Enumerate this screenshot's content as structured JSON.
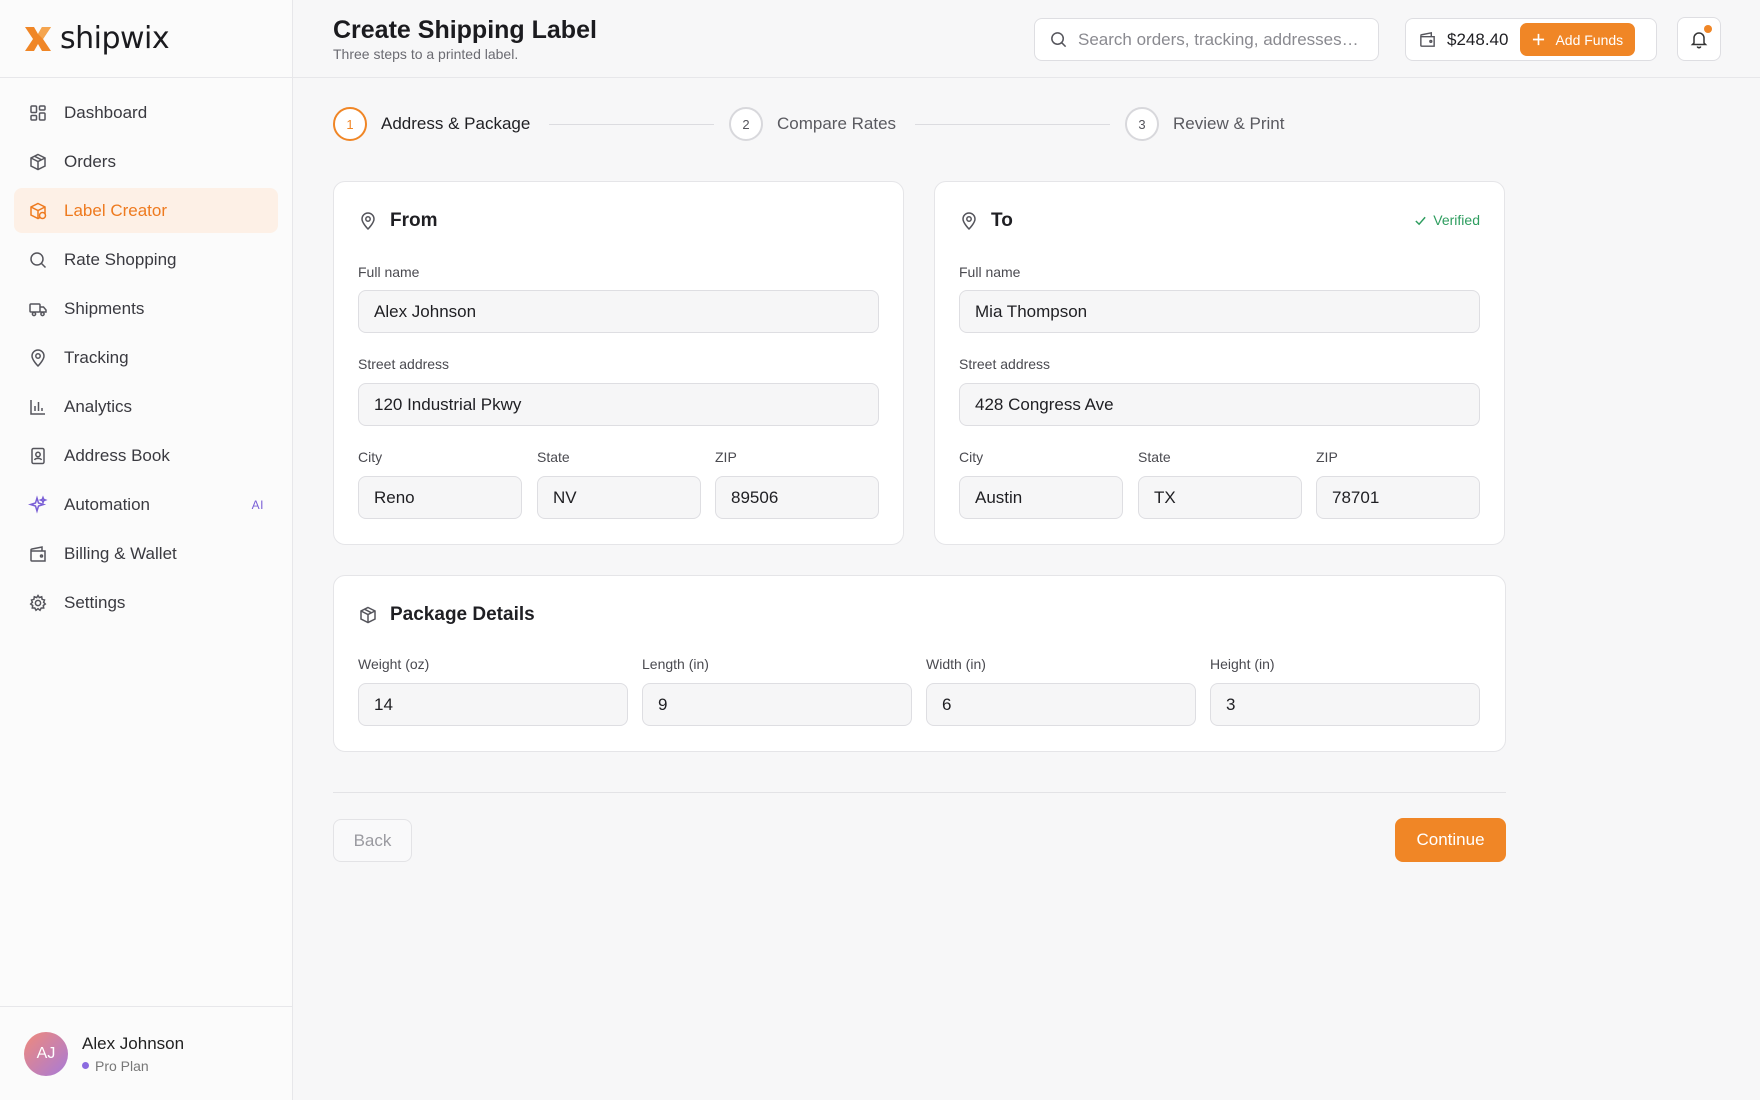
{
  "brand": {
    "name": "shipwix",
    "logo_icon": "x-logo-icon",
    "accent": "#f08626"
  },
  "sidebar": {
    "items": [
      {
        "label": "Dashboard",
        "icon": "grid-icon"
      },
      {
        "label": "Orders",
        "icon": "box-icon"
      },
      {
        "label": "Label Creator",
        "icon": "label-box-icon",
        "active": true
      },
      {
        "label": "Rate Shopping",
        "icon": "search-icon"
      },
      {
        "label": "Shipments",
        "icon": "truck-icon"
      },
      {
        "label": "Tracking",
        "icon": "map-pin-icon"
      },
      {
        "label": "Analytics",
        "icon": "bar-chart-icon"
      },
      {
        "label": "Address Book",
        "icon": "contact-book-icon"
      },
      {
        "label": "Automation",
        "icon": "sparkles-icon",
        "tag": "AI"
      },
      {
        "label": "Billing & Wallet",
        "icon": "wallet-icon"
      },
      {
        "label": "Settings",
        "icon": "gear-icon"
      }
    ],
    "user": {
      "initials": "AJ",
      "name": "Alex Johnson",
      "plan": "Pro Plan"
    }
  },
  "header": {
    "title": "Create Shipping Label",
    "subtitle": "Three steps to a printed label.",
    "search_placeholder": "Search orders, tracking, addresses…",
    "wallet_balance": "$248.40",
    "add_funds_label": "Add Funds"
  },
  "stepper": {
    "steps": [
      {
        "number": "1",
        "label": "Address & Package",
        "active": true
      },
      {
        "number": "2",
        "label": "Compare Rates"
      },
      {
        "number": "3",
        "label": "Review & Print"
      }
    ]
  },
  "from": {
    "title": "From",
    "full_name_label": "Full name",
    "full_name": "Alex Johnson",
    "street_label": "Street address",
    "street": "120 Industrial Pkwy",
    "city_label": "City",
    "city": "Reno",
    "state_label": "State",
    "state": "NV",
    "zip_label": "ZIP",
    "zip": "89506"
  },
  "to": {
    "title": "To",
    "verified_label": "Verified",
    "full_name_label": "Full name",
    "full_name": "Mia Thompson",
    "street_label": "Street address",
    "street": "428 Congress Ave",
    "city_label": "City",
    "city": "Austin",
    "state_label": "State",
    "state": "TX",
    "zip_label": "ZIP",
    "zip": "78701"
  },
  "package": {
    "title": "Package Details",
    "weight_label": "Weight (oz)",
    "weight": "14",
    "length_label": "Length (in)",
    "length": "9",
    "width_label": "Width (in)",
    "width": "6",
    "height_label": "Height (in)",
    "height": "3"
  },
  "actions": {
    "back_label": "Back",
    "continue_label": "Continue"
  }
}
